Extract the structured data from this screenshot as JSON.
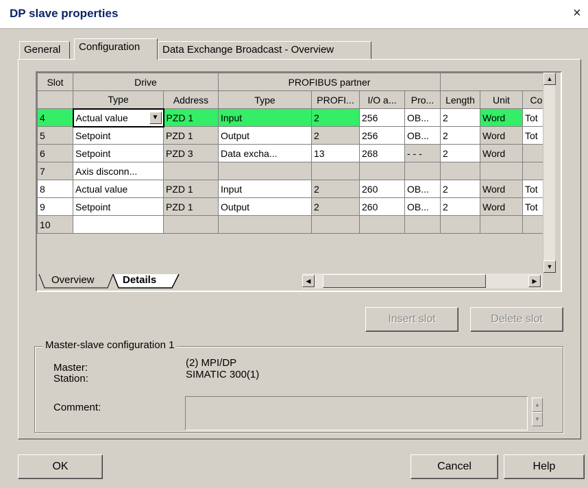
{
  "window": {
    "title": "DP slave properties",
    "close": "×"
  },
  "tabs": [
    "General",
    "Configuration",
    "Data Exchange Broadcast - Overview"
  ],
  "grid": {
    "group_headers": {
      "slot": "Slot",
      "drive": "Drive",
      "partner": "PROFIBUS partner"
    },
    "columns": [
      "Type",
      "Address",
      "Type",
      "PROFI...",
      "I/O a...",
      "Pro...",
      "Length",
      "Unit",
      "Co"
    ],
    "rows": [
      [
        "4",
        "Actual value",
        "PZD 1",
        "Input",
        "2",
        "256",
        "OB...",
        "2",
        "Word",
        "Tot"
      ],
      [
        "5",
        "Setpoint",
        "PZD 1",
        "Output",
        "2",
        "256",
        "OB...",
        "2",
        "Word",
        "Tot"
      ],
      [
        "6",
        "Setpoint",
        "PZD 3",
        "Data excha...",
        "13",
        "268",
        "- - -",
        "2",
        "Word",
        ""
      ],
      [
        "7",
        "Axis disconn...",
        "",
        "",
        "",
        "",
        "",
        "",
        "",
        ""
      ],
      [
        "8",
        "Actual value",
        "PZD 1",
        "Input",
        "2",
        "260",
        "OB...",
        "2",
        "Word",
        "Tot"
      ],
      [
        "9",
        "Setpoint",
        "PZD 1",
        "Output",
        "2",
        "260",
        "OB...",
        "2",
        "Word",
        "Tot"
      ],
      [
        "10",
        "",
        "",
        "",
        "",
        "",
        "",
        "",
        "",
        ""
      ]
    ],
    "selected_color": "#33ee66"
  },
  "sheet_tabs": {
    "overview": "Overview",
    "details": "Details"
  },
  "buttons": {
    "insert_slot": "Insert slot",
    "delete_slot": "Delete slot",
    "ok": "OK",
    "cancel": "Cancel",
    "help": "Help"
  },
  "config": {
    "legend": "Master-slave configuration 1",
    "master_label": "Master:",
    "master_value": "(2) MPI/DP",
    "station_label": "Station:",
    "station_value": "SIMATIC 300(1)",
    "comment_label": "Comment:",
    "comment_value": ""
  },
  "icons": {
    "close": "close-icon",
    "dropdown": "chevron-down-icon",
    "scroll_up": "arrow-up-icon",
    "scroll_down": "arrow-down-icon",
    "scroll_left": "arrow-left-icon",
    "scroll_right": "arrow-right-icon"
  }
}
